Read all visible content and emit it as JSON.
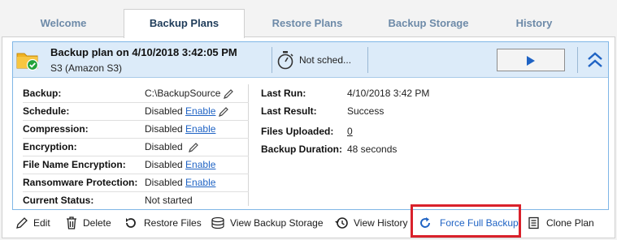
{
  "tabs": [
    {
      "label": "Welcome",
      "active": false
    },
    {
      "label": "Backup Plans",
      "active": true
    },
    {
      "label": "Restore Plans",
      "active": false
    },
    {
      "label": "Backup Storage",
      "active": false
    },
    {
      "label": "History",
      "active": false
    }
  ],
  "plan": {
    "title": "Backup plan on 4/10/2018 3:42:05 PM",
    "storage": "S3 (Amazon S3)",
    "schedule_status": "Not sched..."
  },
  "details_left": [
    {
      "label": "Backup:",
      "value": "C:\\BackupSource",
      "link": ""
    },
    {
      "label": "Schedule:",
      "value": "Disabled",
      "link": "Enable"
    },
    {
      "label": "Compression:",
      "value": "Disabled",
      "link": "Enable"
    },
    {
      "label": "Encryption:",
      "value": "Disabled",
      "link": ""
    },
    {
      "label": "File Name Encryption:",
      "value": "Disabled",
      "link": "Enable"
    },
    {
      "label": "Ransomware Protection:",
      "value": "Disabled",
      "link": "Enable"
    },
    {
      "label": "Current Status:",
      "value": "Not started",
      "link": ""
    }
  ],
  "details_right": [
    {
      "label": "Last Run:",
      "value": "4/10/2018 3:42 PM"
    },
    {
      "label": "Last Result:",
      "value": "Success"
    },
    {
      "label": "Files Uploaded:",
      "value": "0"
    },
    {
      "label": "Backup Duration:",
      "value": "48 seconds"
    }
  ],
  "toolbar": {
    "edit": "Edit",
    "delete": "Delete",
    "restore_files": "Restore Files",
    "view_backup_storage": "View Backup Storage",
    "view_history": "View History",
    "force_full_backup": "Force Full Backup",
    "clone_plan": "Clone Plan"
  },
  "colors": {
    "accent": "#1f63c4",
    "header_bg": "#dcebf9",
    "highlight": "#d9212b",
    "success": "#22a33a"
  },
  "icons": {
    "plan": "folder-success-icon",
    "schedule": "stopwatch-icon",
    "run": "play-icon",
    "collapse": "double-chevron-up-icon"
  }
}
